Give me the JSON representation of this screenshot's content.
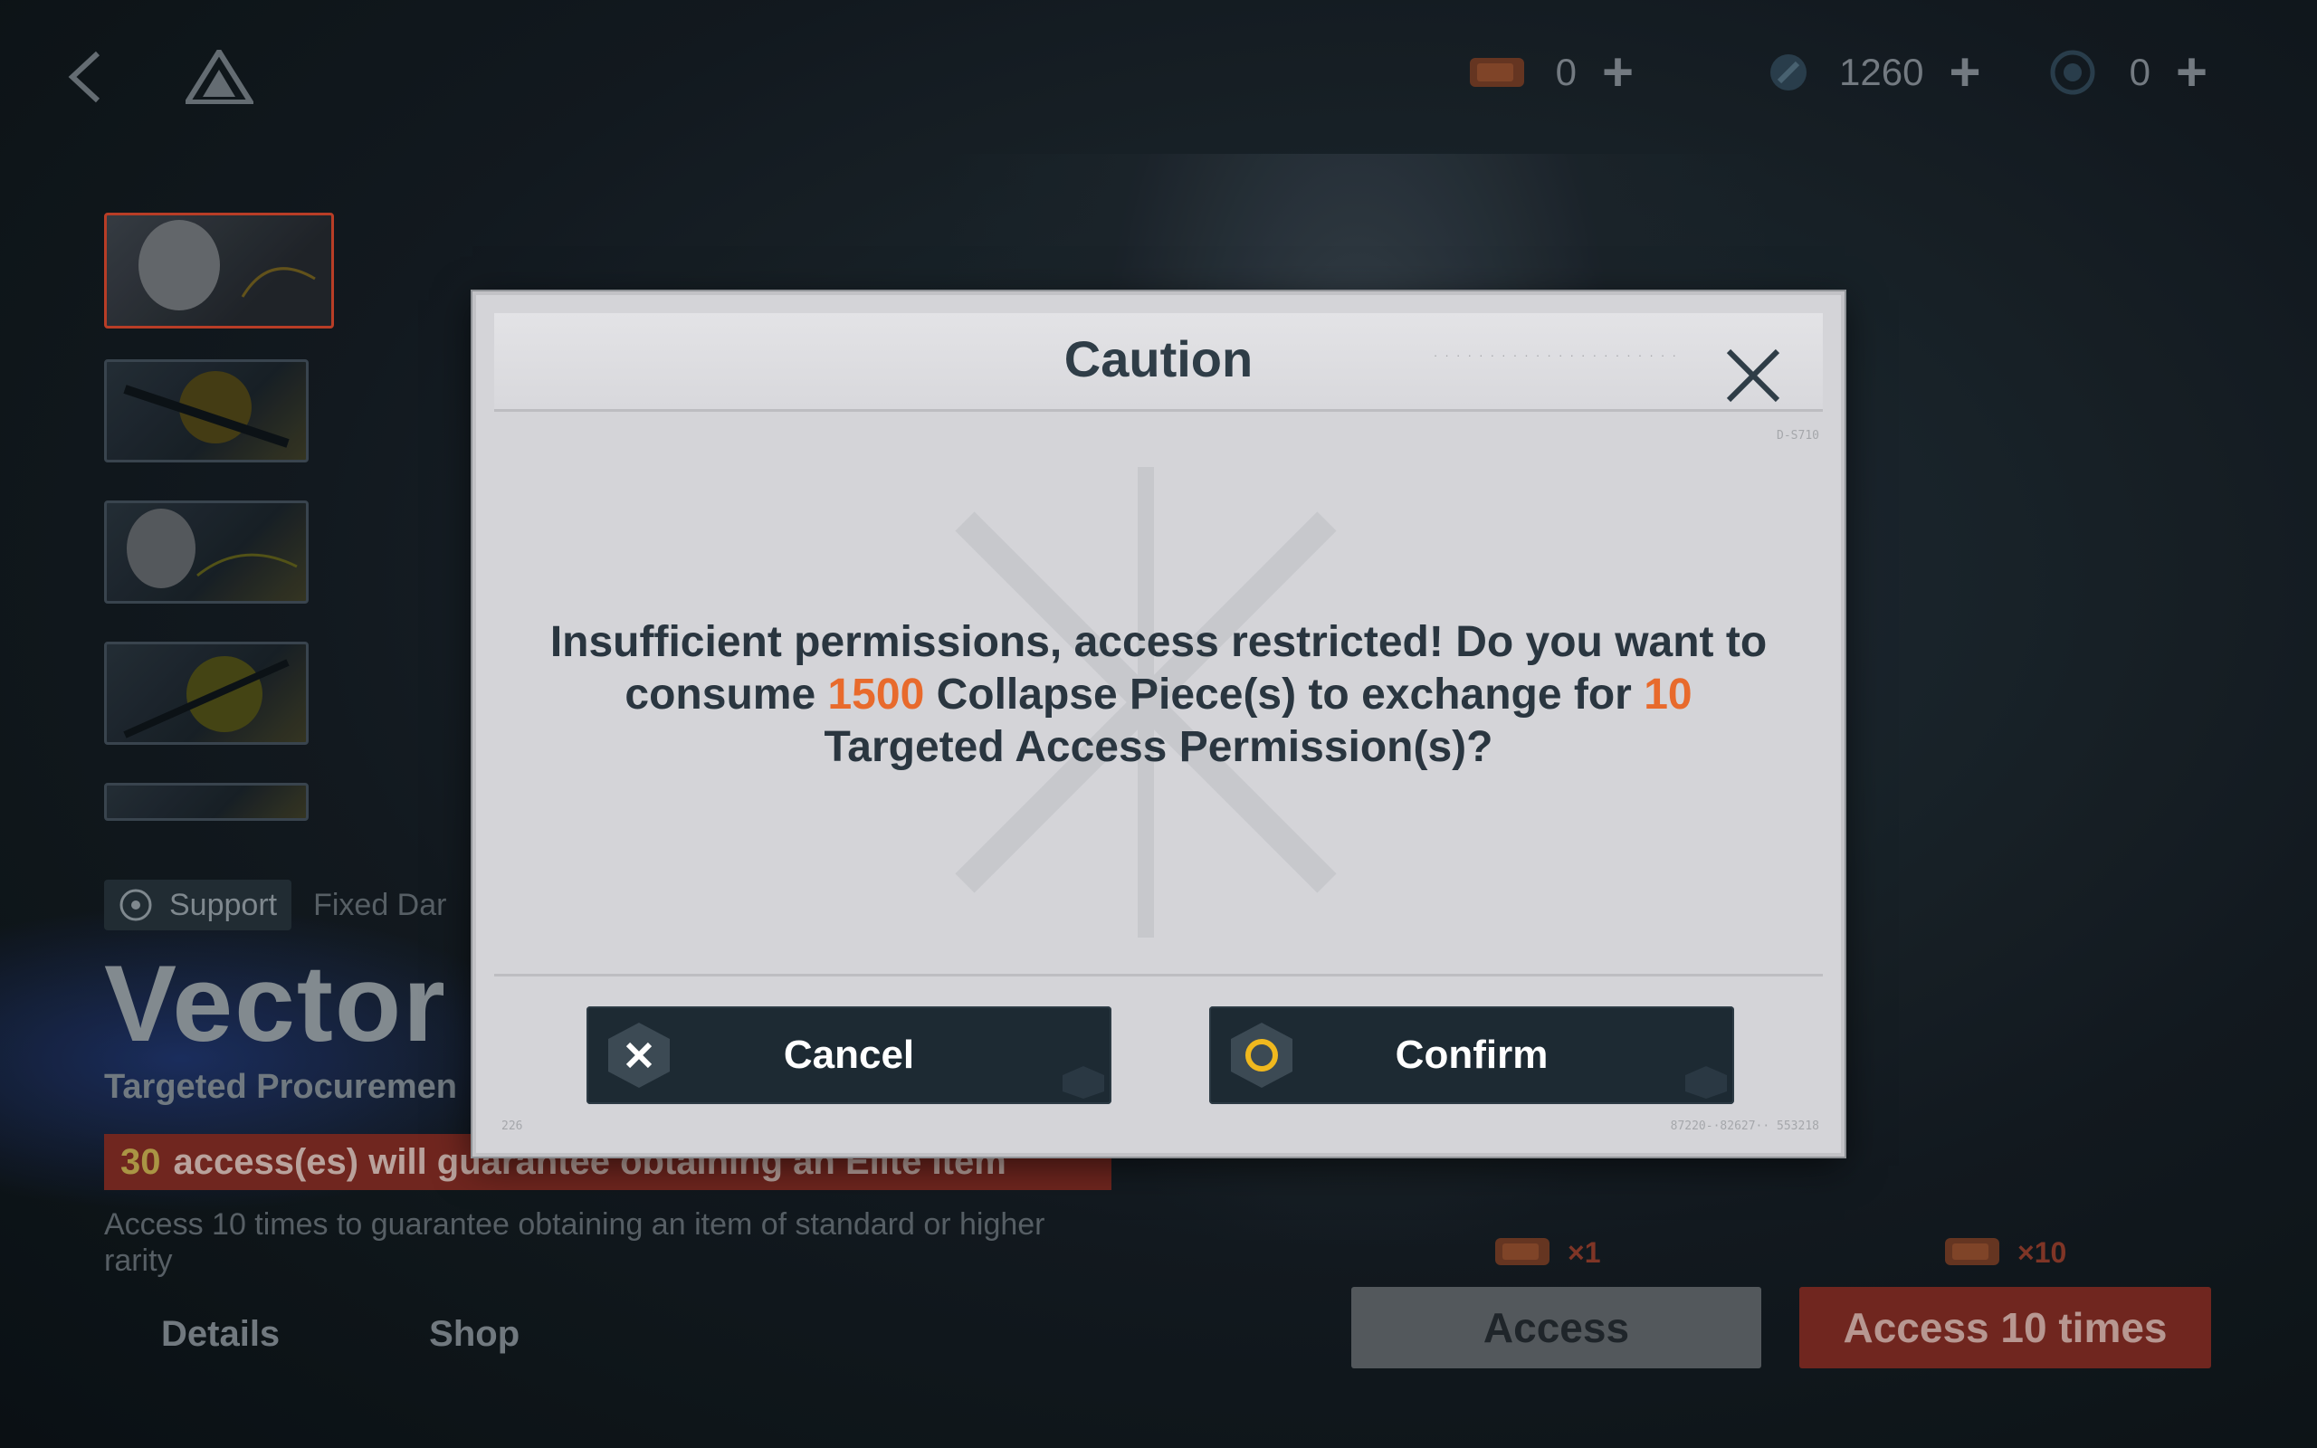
{
  "topbar": {
    "currencies": [
      {
        "icon": "targeted-permission-ticket-icon",
        "value": "0"
      },
      {
        "icon": "collapse-piece-icon",
        "value": "1260"
      },
      {
        "icon": "crystal-currency-icon",
        "value": "0"
      }
    ],
    "plus": "+"
  },
  "tags": {
    "role": "Support",
    "extra": "Fixed Dar"
  },
  "banner": {
    "character": "Vector",
    "subtitle": "Targeted Procuremen",
    "guarantee_count": "30",
    "guarantee_text": "access(es) will guarantee obtaining an Elite Item",
    "description": "Access 10 times to guarantee obtaining an item of standard or higher rarity"
  },
  "tabs": [
    "Details",
    "Shop"
  ],
  "access": {
    "single_cost": "×1",
    "multi_cost": "×10",
    "single_label": "Access",
    "multi_label": "Access 10 times"
  },
  "modal": {
    "title": "Caution",
    "message_part1": "Insufficient permissions, access restricted! Do you want to consume",
    "cost_value": "1500",
    "message_part2": "Collapse Piece(s) to exchange for",
    "ticket_value": "10",
    "message_part3": "Targeted Access Permission(s)?",
    "cancel_label": "Cancel",
    "confirm_label": "Confirm",
    "highlight_color": "#e86a2c"
  }
}
